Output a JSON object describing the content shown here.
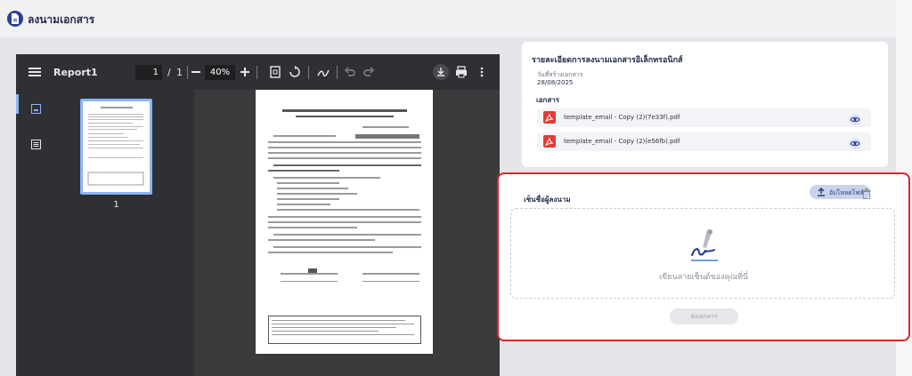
{
  "app": {
    "title": "ลงนามเอกสาร"
  },
  "viewer": {
    "title": "Report1",
    "current_page": "1",
    "page_sep": "/",
    "total_pages": "1",
    "zoom": "40%",
    "thumb_number": "1"
  },
  "details": {
    "title": "รายละเอียดการลงนามเอกสารอิเล็กทรอนิกส์",
    "date_label": "วันที่สร้างเอกสาร",
    "date_value": "28/08/2025",
    "docs_title": "เอกสาร",
    "documents": [
      {
        "name": "template_email - Copy (2)(7e33f).pdf"
      },
      {
        "name": "template_email - Copy (2)(e56fb).pdf"
      }
    ]
  },
  "sign": {
    "title": "เซ็นชื่อผู้ลงนาม",
    "upload_label": "อัปโหลดไฟล์",
    "hint": "เขียนลายเซ็นต์ของคุณที่นี่",
    "send_label": "ส่งเอกสาร"
  },
  "colors": {
    "accent": "#2d3f8f",
    "highlight": "#e0242a",
    "pdf": "#e53935"
  }
}
